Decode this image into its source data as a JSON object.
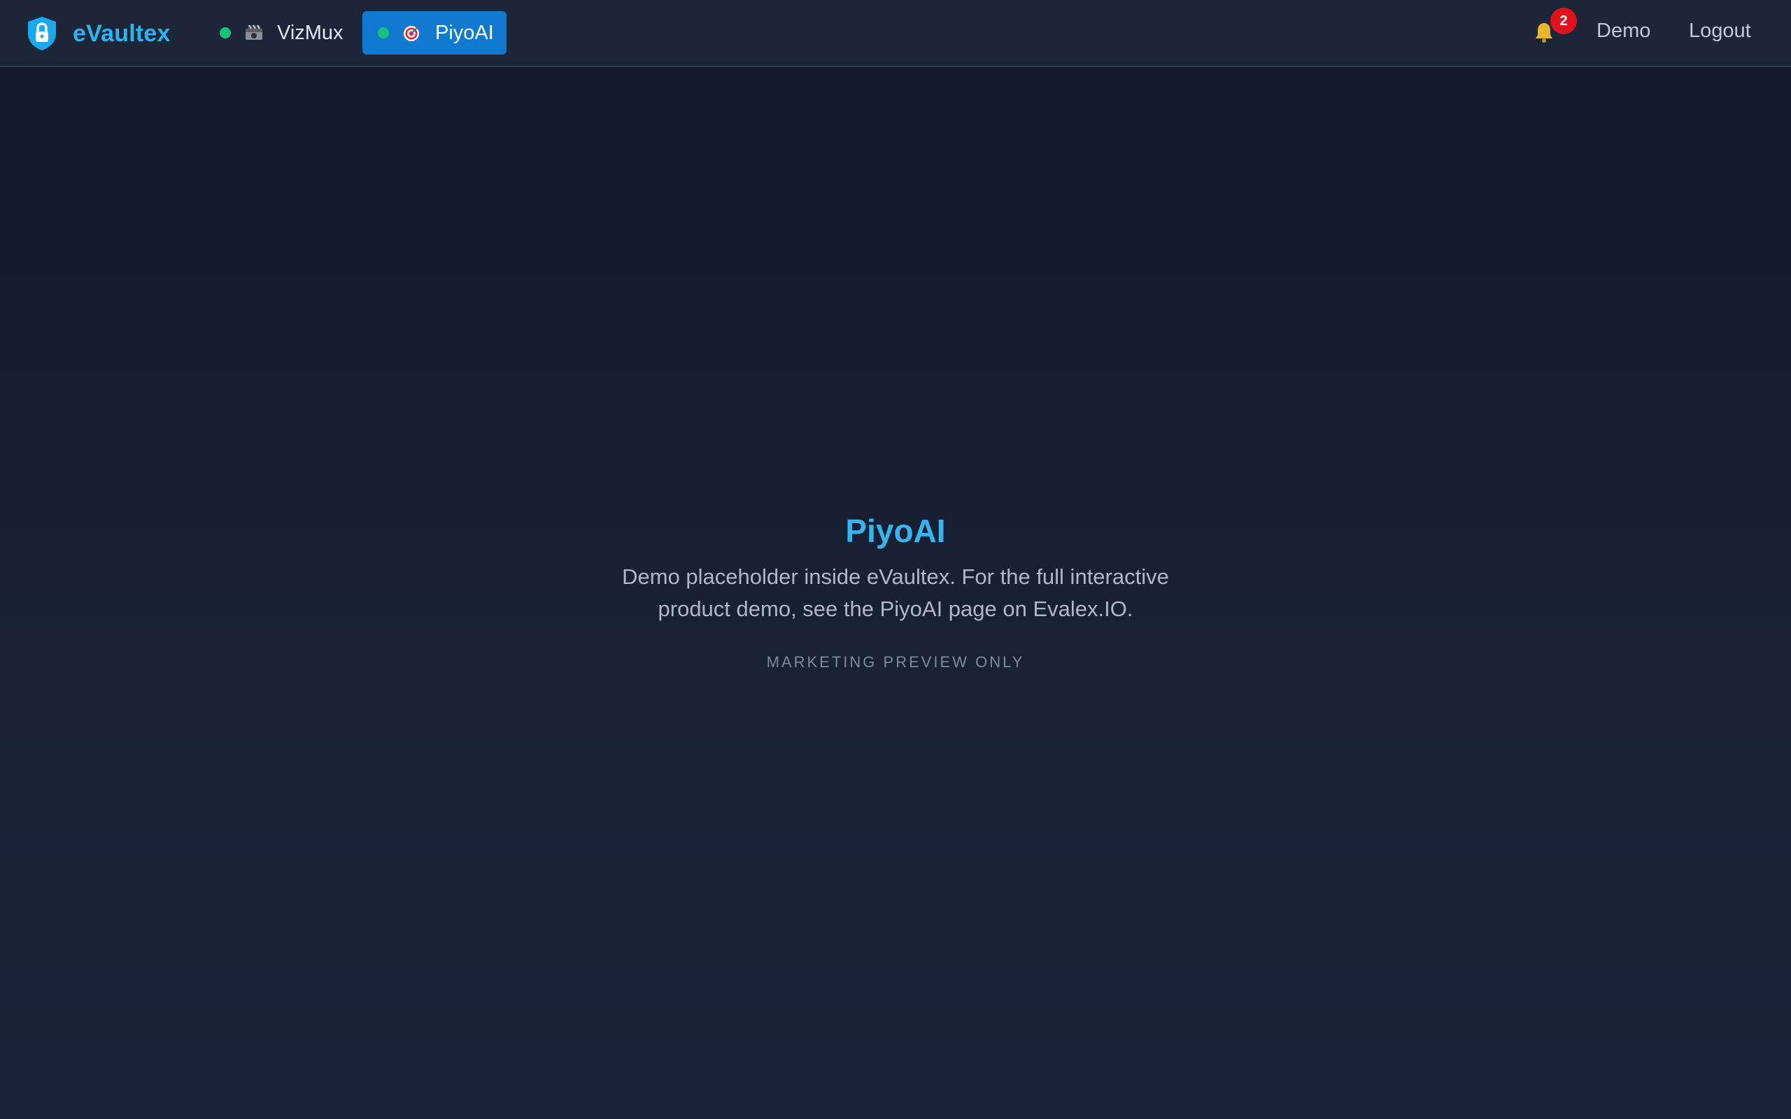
{
  "brand": {
    "name": "eVaultex",
    "icon": "shield-lock-icon",
    "color": "#2bb5f0"
  },
  "apps": [
    {
      "label": "VizMux",
      "icon": "film-camera-icon",
      "status": "online",
      "active": false
    },
    {
      "label": "PiyoAI",
      "icon": "target-icon",
      "status": "online",
      "active": true
    }
  ],
  "nav": {
    "notifications_count": "2",
    "demo_label": "Demo",
    "logout_label": "Logout"
  },
  "main": {
    "title": "PiyoAI",
    "description": "Demo placeholder inside eVaultex. For the full interactive product demo, see the PiyoAI page on Evalex.IO.",
    "footnote": "MARKETING PREVIEW ONLY"
  },
  "colors": {
    "accent": "#0f7ad0",
    "status_online": "#18c27a",
    "badge": "#e0121e",
    "title": "#35b4f2"
  }
}
